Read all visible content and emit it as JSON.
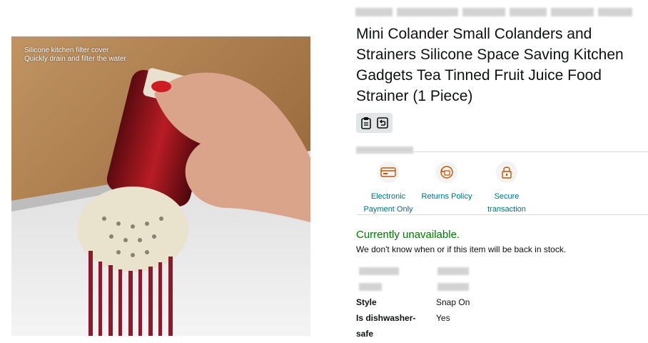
{
  "image": {
    "caption_line1": "Silicone kitchen filter cover",
    "caption_line2": "Quickly drain and filter the water"
  },
  "product": {
    "title": "Mini Colander Small Colanders and Strainers Silicone Space Saving Kitchen Gadgets Tea Tinned Fruit Juice Food Strainer (1 Piece)"
  },
  "badges": [
    "clipboard-icon",
    "return-icon"
  ],
  "trust": [
    {
      "icon": "payment-card-icon",
      "line1": "Electronic",
      "line2": "Payment Only"
    },
    {
      "icon": "returns-icon",
      "line1": "Returns Policy",
      "line2": ""
    },
    {
      "icon": "lock-icon",
      "line1": "Secure",
      "line2": "transaction"
    }
  ],
  "availability": {
    "status": "Currently unavailable.",
    "note": "We don't know when or if this item will be back in stock."
  },
  "details": [
    {
      "key": "Style",
      "value": "Snap On"
    },
    {
      "key": "Is dishwasher-",
      "value": "Yes"
    },
    {
      "key": "safe",
      "value": ""
    }
  ],
  "colors": {
    "link": "#007185",
    "available": "#007600",
    "text": "#0f1111"
  }
}
